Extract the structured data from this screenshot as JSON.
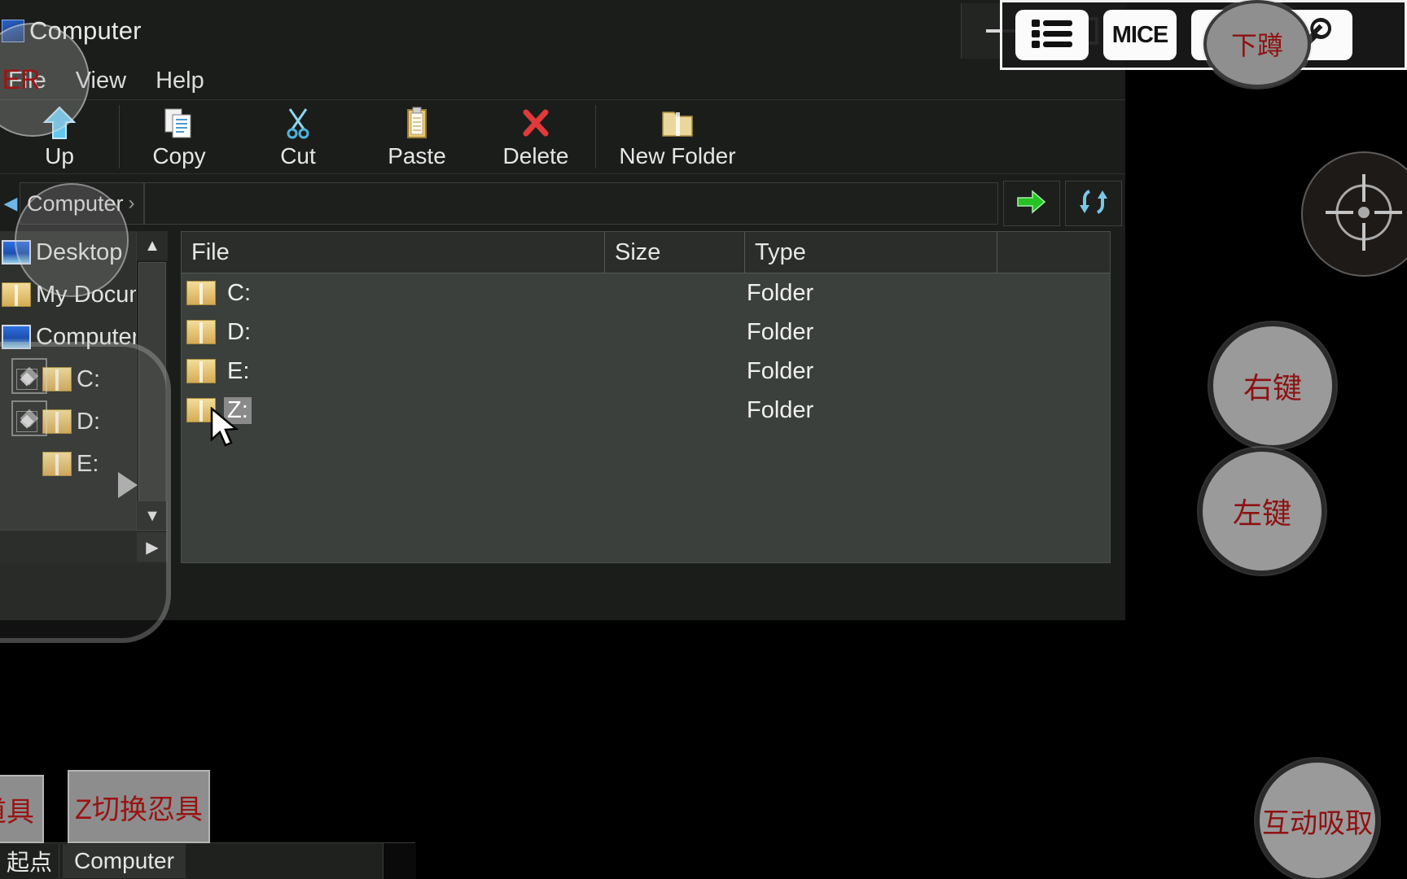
{
  "window": {
    "title": "Computer",
    "icon": "computer-icon",
    "controls": {
      "minimize": "minimize-icon",
      "maximize": "maximize-icon"
    }
  },
  "menubar": {
    "items": [
      {
        "label": "File",
        "name": "menu-file"
      },
      {
        "label": "View",
        "name": "menu-view"
      },
      {
        "label": "Help",
        "name": "menu-help"
      }
    ]
  },
  "toolbar": {
    "buttons": [
      {
        "label": "Up",
        "icon": "up-arrow-icon"
      },
      {
        "label": "Copy",
        "icon": "copy-icon"
      },
      {
        "label": "Cut",
        "icon": "scissors-icon"
      },
      {
        "label": "Paste",
        "icon": "clipboard-icon"
      },
      {
        "label": "Delete",
        "icon": "red-x-icon"
      },
      {
        "label": "New Folder",
        "icon": "new-folder-icon"
      }
    ]
  },
  "addressbar": {
    "crumb": "Computer",
    "crumb_separator": "›",
    "path_value": "",
    "path_placeholder": "",
    "go_icon": "green-arrow-right-icon",
    "refresh_icon": "refresh-icon"
  },
  "tree": {
    "items": [
      {
        "label": "Desktop",
        "icon": "desktop-icon",
        "indent": 0,
        "expander": false
      },
      {
        "label": "My Documents",
        "icon": "folder-icon",
        "indent": 0,
        "expander": false
      },
      {
        "label": "Computer",
        "icon": "computer-icon",
        "indent": 0,
        "expander": false
      },
      {
        "label": "C:",
        "icon": "folder-icon",
        "indent": 1,
        "expander": true
      },
      {
        "label": "D:",
        "icon": "folder-icon",
        "indent": 1,
        "expander": true
      },
      {
        "label": "E:",
        "icon": "folder-icon",
        "indent": 1,
        "expander": false
      }
    ],
    "scroll_up": "▲",
    "scroll_down": "▼",
    "scroll_right": "▶"
  },
  "filelist": {
    "columns": [
      "File",
      "Size",
      "Type",
      ""
    ],
    "rows": [
      {
        "file": "C:",
        "size": "",
        "type": "Folder",
        "selected": false
      },
      {
        "file": "D:",
        "size": "",
        "type": "Folder",
        "selected": false
      },
      {
        "file": "E:",
        "size": "",
        "type": "Folder",
        "selected": false
      },
      {
        "file": "Z:",
        "size": "",
        "type": "Folder",
        "selected": true
      }
    ]
  },
  "taskbar": {
    "start_label": "起点",
    "items": [
      {
        "label": "Computer"
      }
    ]
  },
  "overlay": {
    "toolbar_buttons": [
      {
        "name": "list-icon",
        "label": ""
      },
      {
        "name": "mice-button",
        "label": "MICE"
      },
      {
        "name": "gamepad-icon",
        "label": ""
      },
      {
        "name": "wrench-icon",
        "label": ""
      }
    ],
    "round_buttons": [
      {
        "name": "right-click-button",
        "label": "右键"
      },
      {
        "name": "left-click-button",
        "label": "左键"
      },
      {
        "name": "interact-button",
        "label": "互动吸取"
      },
      {
        "name": "crouch-button",
        "label": "下蹲"
      }
    ],
    "aim_button": {
      "name": "aim-crosshair-button",
      "label": ""
    },
    "key_buttons": [
      {
        "name": "item-key-button",
        "label": "道具"
      },
      {
        "name": "switch-key-button",
        "label": "Z切换忍具"
      }
    ],
    "left_stick_label": "ER"
  },
  "colors": {
    "accent_green": "#25c225",
    "accent_blue": "#63c7f0",
    "folder_yellow": "#e3c46b",
    "red_label": "#9b1212",
    "window_bg": "#1b1d1b",
    "list_bg": "#3c403c"
  }
}
